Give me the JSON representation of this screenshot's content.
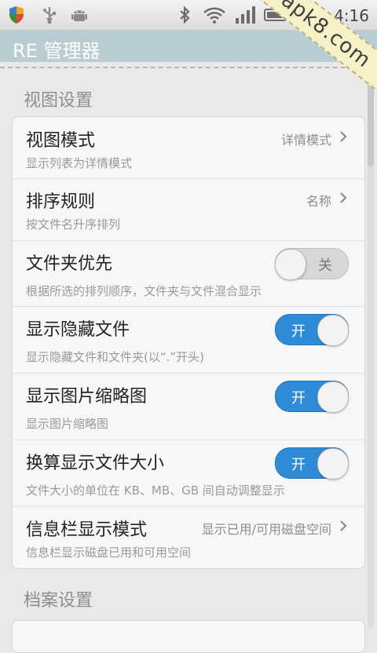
{
  "status_bar": {
    "time": "4:16",
    "icons": [
      "shield-icon",
      "usb-icon",
      "android-icon",
      "bluetooth-icon",
      "wifi-icon",
      "signal-icon",
      "battery-icon",
      "alarm-icon"
    ]
  },
  "watermark": "apk8.com",
  "app": {
    "title": "RE 管理器"
  },
  "sections": [
    {
      "header": "视图设置",
      "rows": [
        {
          "title": "视图模式",
          "subtitle": "显示列表为详情模式",
          "value": "详情模式"
        },
        {
          "title": "排序规则",
          "subtitle": "按文件名升序排列",
          "value": "名称"
        },
        {
          "title": "文件夹优先",
          "subtitle": "根据所选的排列顺序，文件夹与文件混合显示",
          "toggle": "关",
          "toggle_on": false
        },
        {
          "title": "显示隐藏文件",
          "subtitle": "显示隐藏文件和文件夹(以“.”开头)",
          "toggle": "开",
          "toggle_on": true
        },
        {
          "title": "显示图片缩略图",
          "subtitle": "显示图片缩略图",
          "toggle": "开",
          "toggle_on": true
        },
        {
          "title": "换算显示文件大小",
          "subtitle": "文件大小的单位在 KB、MB、GB 间自动调整显示",
          "toggle": "开",
          "toggle_on": true
        },
        {
          "title": "信息栏显示模式",
          "subtitle": "信息栏显示磁盘已用和可用空间",
          "value": "显示已用/可用磁盘空间"
        }
      ]
    },
    {
      "header": "档案设置"
    }
  ],
  "colors": {
    "toggle_on": "#2d8bd8",
    "title_bar": "#b9ccd1"
  }
}
